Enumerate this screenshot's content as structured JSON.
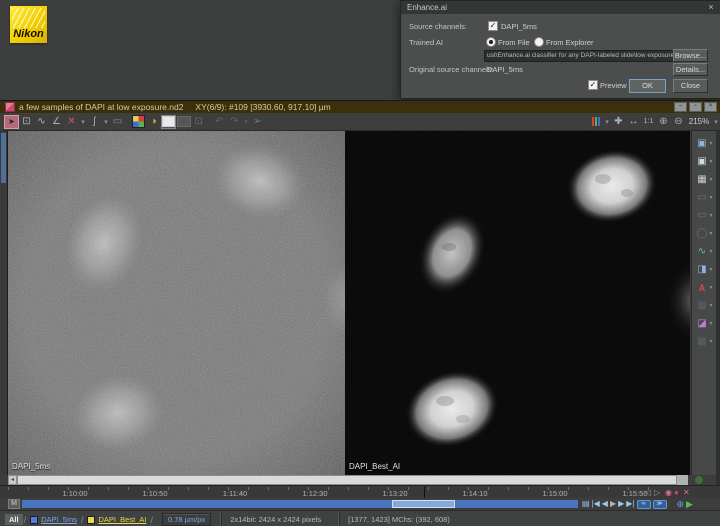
{
  "brand": {
    "name": "Nikon"
  },
  "dialog": {
    "title": "Enhance.ai",
    "source_channels_label": "Source channels:",
    "source_channel": "DAPI_5ms",
    "trained_ai_label": "Trained AI",
    "from_file": "From File",
    "from_explorer": "From Explorer",
    "classifier_path": "ust\\Enhance.ai classifier for any DAPI-labeled slide\\low exposure DAPI.eai",
    "browse": "Browse...",
    "original_source_label": "Original source channels:",
    "original_source": "DAPI_5ms",
    "details": "Details...",
    "preview": "Preview",
    "ok": "OK",
    "close": "Close"
  },
  "window": {
    "title": "a few samples of DAPI at low exposure.nd2",
    "position": "XY(6/9): #109 [3930.60, 917.10] µm",
    "zoom_level": "215%",
    "one_to_one": "1:1"
  },
  "viewer": {
    "left_label": "DAPI_5ms",
    "right_label": "DAPI_Best_AI"
  },
  "timeline": {
    "ticks": [
      "1:10:00",
      "1:10:50",
      "1:11:40",
      "1:12:30",
      "1:13:20",
      "1:14:10",
      "1:15:00",
      "1:15:50"
    ],
    "m": "M"
  },
  "statusbar": {
    "all": "All",
    "ch1": "DAPI_5ms",
    "ch2": "DAPI_Best_AI",
    "scale": "0.78 µm/px",
    "bits": "2x14bit: 2424 x 2424 pixels",
    "coords": "[1377, 1423] MChs: (392, 608)"
  },
  "sidebar_icons": [
    "▣",
    "▣",
    "▦",
    "▭",
    "▭",
    "◯",
    "∿",
    "◨",
    "A",
    "▦",
    "◪",
    "▦"
  ],
  "icons": {
    "close_x": "×",
    "check": "✓",
    "caret_down": "▾",
    "pointer": "➤",
    "roi_frame": "⊡",
    "profile": "∿",
    "angle": "∠",
    "clear_roi": "✕",
    "spline": "ʃ",
    "ruler": "▭",
    "brightness": "◑",
    "undo": "↶",
    "redo": "↷",
    "send": "➢",
    "pan": "✚",
    "fit": "↔",
    "zoom_in": "⊕",
    "zoom_out": "⊖",
    "minimize": "–",
    "restore": "▫",
    "scroll_left": "◂",
    "film": "▤",
    "jump_first": "|◀",
    "step_back": "◀",
    "play": "▶",
    "step_fwd": "▶",
    "jump_last": "▶|",
    "loop": "∞",
    "speed": "≫",
    "add": "⊕",
    "live": "▶",
    "event_prev": "◁",
    "event_next": "▷",
    "pin": "◉",
    "record": "●",
    "dismiss": "✕",
    "tab_separator": "/"
  },
  "colors": {
    "accent_blue": "#4a74bc",
    "channel_blue": "#5a7ae0",
    "channel_yellow": "#e8d84a",
    "nikon_yellow": "#f2cf00",
    "titlebar_olive": "#3b2f0d"
  }
}
